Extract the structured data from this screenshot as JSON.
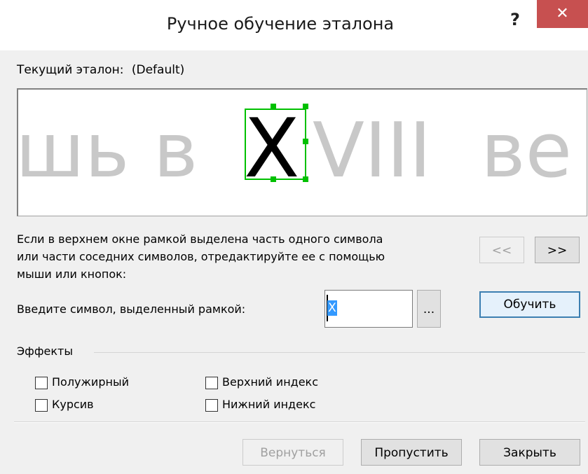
{
  "window": {
    "title": "Ручное обучение эталона",
    "help_glyph": "?",
    "close_glyph": "✕"
  },
  "current": {
    "label": "Текущий эталон:",
    "value": "(Default)"
  },
  "preview": {
    "left_text": "шь в",
    "selected_char": "X",
    "right_text": "VIII",
    "tail_text": "ве"
  },
  "instructions": {
    "line1": "Если в верхнем окне рамкой выделена часть одного символа",
    "line2": "или части соседних символов, отредактируйте ее с помощью",
    "line3": "мыши или кнопок:"
  },
  "nav": {
    "prev_label": "<<",
    "next_label": ">>"
  },
  "symbol": {
    "label": "Введите символ, выделенный рамкой:",
    "value": "X",
    "browse_label": "...",
    "train_label": "Обучить"
  },
  "effects": {
    "group_label": "Эффекты",
    "bold": "Полужирный",
    "italic": "Курсив",
    "superscript": "Верхний индекс",
    "subscript": "Нижний индекс"
  },
  "footer": {
    "back_label": "Вернуться",
    "skip_label": "Пропустить",
    "close_label": "Закрыть"
  },
  "colors": {
    "close_button": "#c75050",
    "selection_frame": "#00c000",
    "ghost_text": "#c8c8c8"
  }
}
